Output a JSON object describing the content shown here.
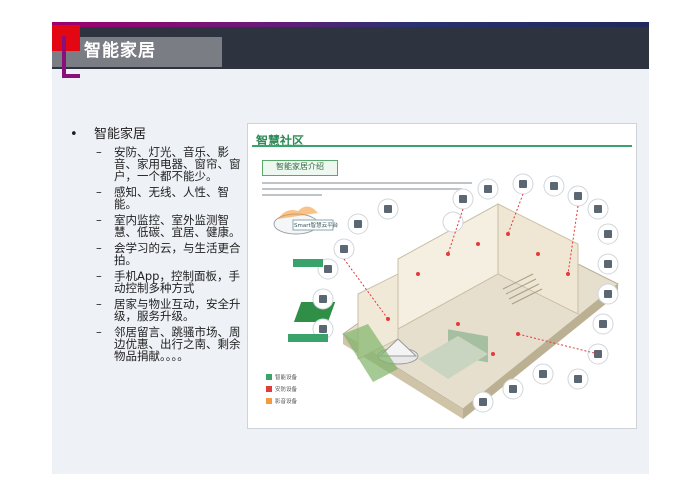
{
  "slide": {
    "title": "智能家居"
  },
  "content": {
    "bullet": "智能家居",
    "items": [
      "安防、灯光、音乐、影音、家用电器、窗帘、窗户，一个都不能少。",
      "感知、无线、人性、智能。",
      "室内监控、室外监测智慧、低碳、宜居、健康。",
      "会学习的云，与生活更合拍。",
      "手机App，控制面板，手动控制多种方式",
      "居家与物业互动，安全升级，服务升级。",
      "邻居留言、跳骚市场、周边优惠、出行之南、剩余物品捐献。。。。"
    ]
  },
  "figure": {
    "header": "智慧社区",
    "subtitle": "智能家居介绍",
    "cloud_label": "Smart智慧云平台",
    "legend": [
      "智能设备",
      "安防设备",
      "影音设备"
    ],
    "colors": {
      "green": "#3aa36b",
      "red": "#e23b3b",
      "wall": "#f3ead7"
    }
  }
}
